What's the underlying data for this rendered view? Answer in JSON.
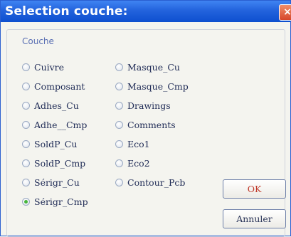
{
  "window": {
    "title": "Selection couche:",
    "close_glyph": "×"
  },
  "group": {
    "label": "Couche"
  },
  "layers_col1": [
    {
      "label": "Cuivre",
      "selected": false
    },
    {
      "label": "Composant",
      "selected": false
    },
    {
      "label": "Adhes_Cu",
      "selected": false
    },
    {
      "label": "Adhe__Cmp",
      "selected": false
    },
    {
      "label": "SoldP_Cu",
      "selected": false
    },
    {
      "label": "SoldP_Cmp",
      "selected": false
    },
    {
      "label": "Sérigr_Cu",
      "selected": false
    },
    {
      "label": "Sérigr_Cmp",
      "selected": true
    }
  ],
  "layers_col2": [
    {
      "label": "Masque_Cu",
      "selected": false
    },
    {
      "label": "Masque_Cmp",
      "selected": false
    },
    {
      "label": "Drawings",
      "selected": false
    },
    {
      "label": "Comments",
      "selected": false
    },
    {
      "label": "Eco1",
      "selected": false
    },
    {
      "label": "Eco2",
      "selected": false
    },
    {
      "label": "Contour_Pcb",
      "selected": false
    }
  ],
  "buttons": {
    "ok": "OK",
    "cancel": "Annuler"
  },
  "colors": {
    "titlebar": "#2363dd",
    "ok_text": "#c03a2b",
    "selected_dot": "#46b53a"
  }
}
